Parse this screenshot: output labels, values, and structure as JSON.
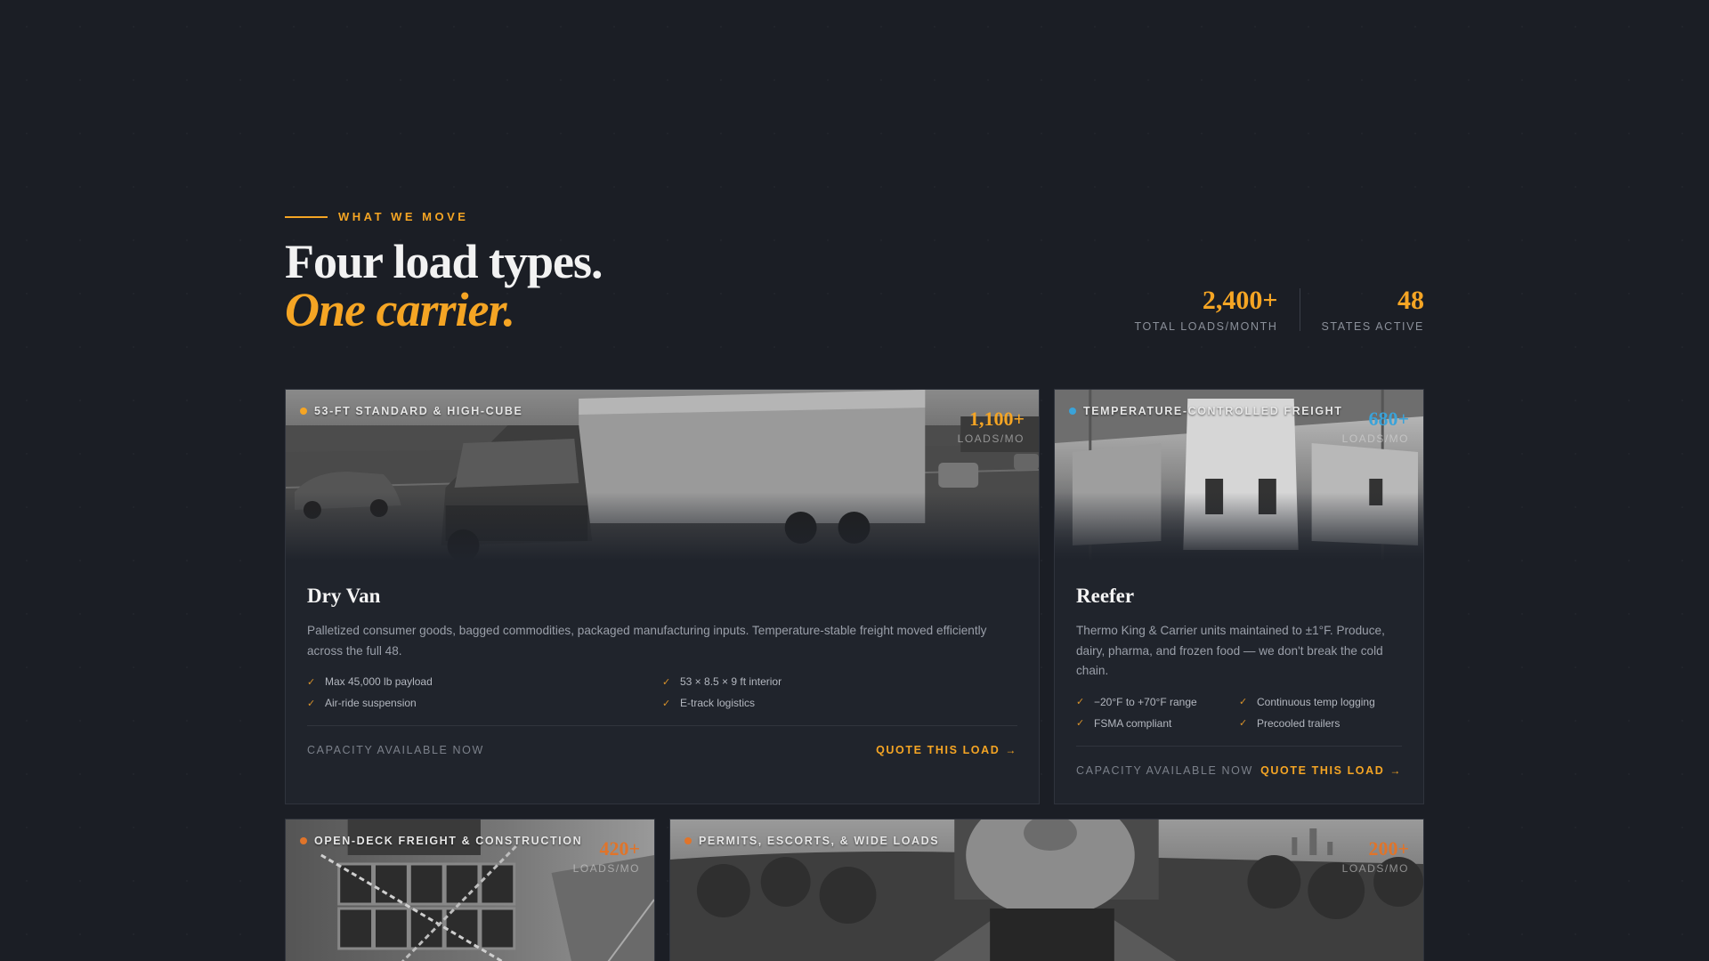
{
  "header": {
    "eyebrow": "WHAT WE MOVE",
    "title_line1": "Four load types.",
    "title_line2": "One carrier.",
    "stats": [
      {
        "value": "2,400+",
        "label": "TOTAL LOADS/MONTH"
      },
      {
        "value": "48",
        "label": "STATES ACTIVE"
      }
    ]
  },
  "colors": {
    "accent": "#f5a524",
    "reefer_accent": "#3aa3d9",
    "flatbed_accent": "#e0742a",
    "oversize_accent": "#e0742a"
  },
  "cards": [
    {
      "tag": "53-FT STANDARD & HIGH-CUBE",
      "loads_value": "1,100+",
      "loads_label": "LOADS/MO",
      "title": "Dry Van",
      "description": "Palletized consumer goods, bagged commodities, packaged manufacturing inputs. Temperature-stable freight moved efficiently across the full 48.",
      "features": [
        "Max 45,000 lb payload",
        "53 × 8.5 × 9 ft interior",
        "Air-ride suspension",
        "E-track logistics"
      ],
      "capacity": "CAPACITY AVAILABLE NOW",
      "cta": "QUOTE THIS LOAD",
      "photo_icon": "truck-highway-photo"
    },
    {
      "tag": "TEMPERATURE-CONTROLLED FREIGHT",
      "loads_value": "680+",
      "loads_label": "LOADS/MO",
      "title": "Reefer",
      "description": "Thermo King & Carrier units maintained to ±1°F. Produce, dairy, pharma, and frozen food — we don't break the cold chain.",
      "features": [
        "−20°F to +70°F range",
        "Continuous temp logging",
        "FSMA compliant",
        "Precooled trailers"
      ],
      "capacity": "CAPACITY AVAILABLE NOW",
      "cta": "QUOTE THIS LOAD",
      "photo_icon": "reefer-trailers-photo"
    },
    {
      "tag": "OPEN-DECK FREIGHT & CONSTRUCTION",
      "loads_value": "420+",
      "loads_label": "LOADS/MO",
      "photo_icon": "flatbed-steel-photo"
    },
    {
      "tag": "PERMITS, ESCORTS, & WIDE LOADS",
      "loads_value": "200+",
      "loads_label": "LOADS/MO",
      "photo_icon": "oversize-load-photo"
    }
  ]
}
